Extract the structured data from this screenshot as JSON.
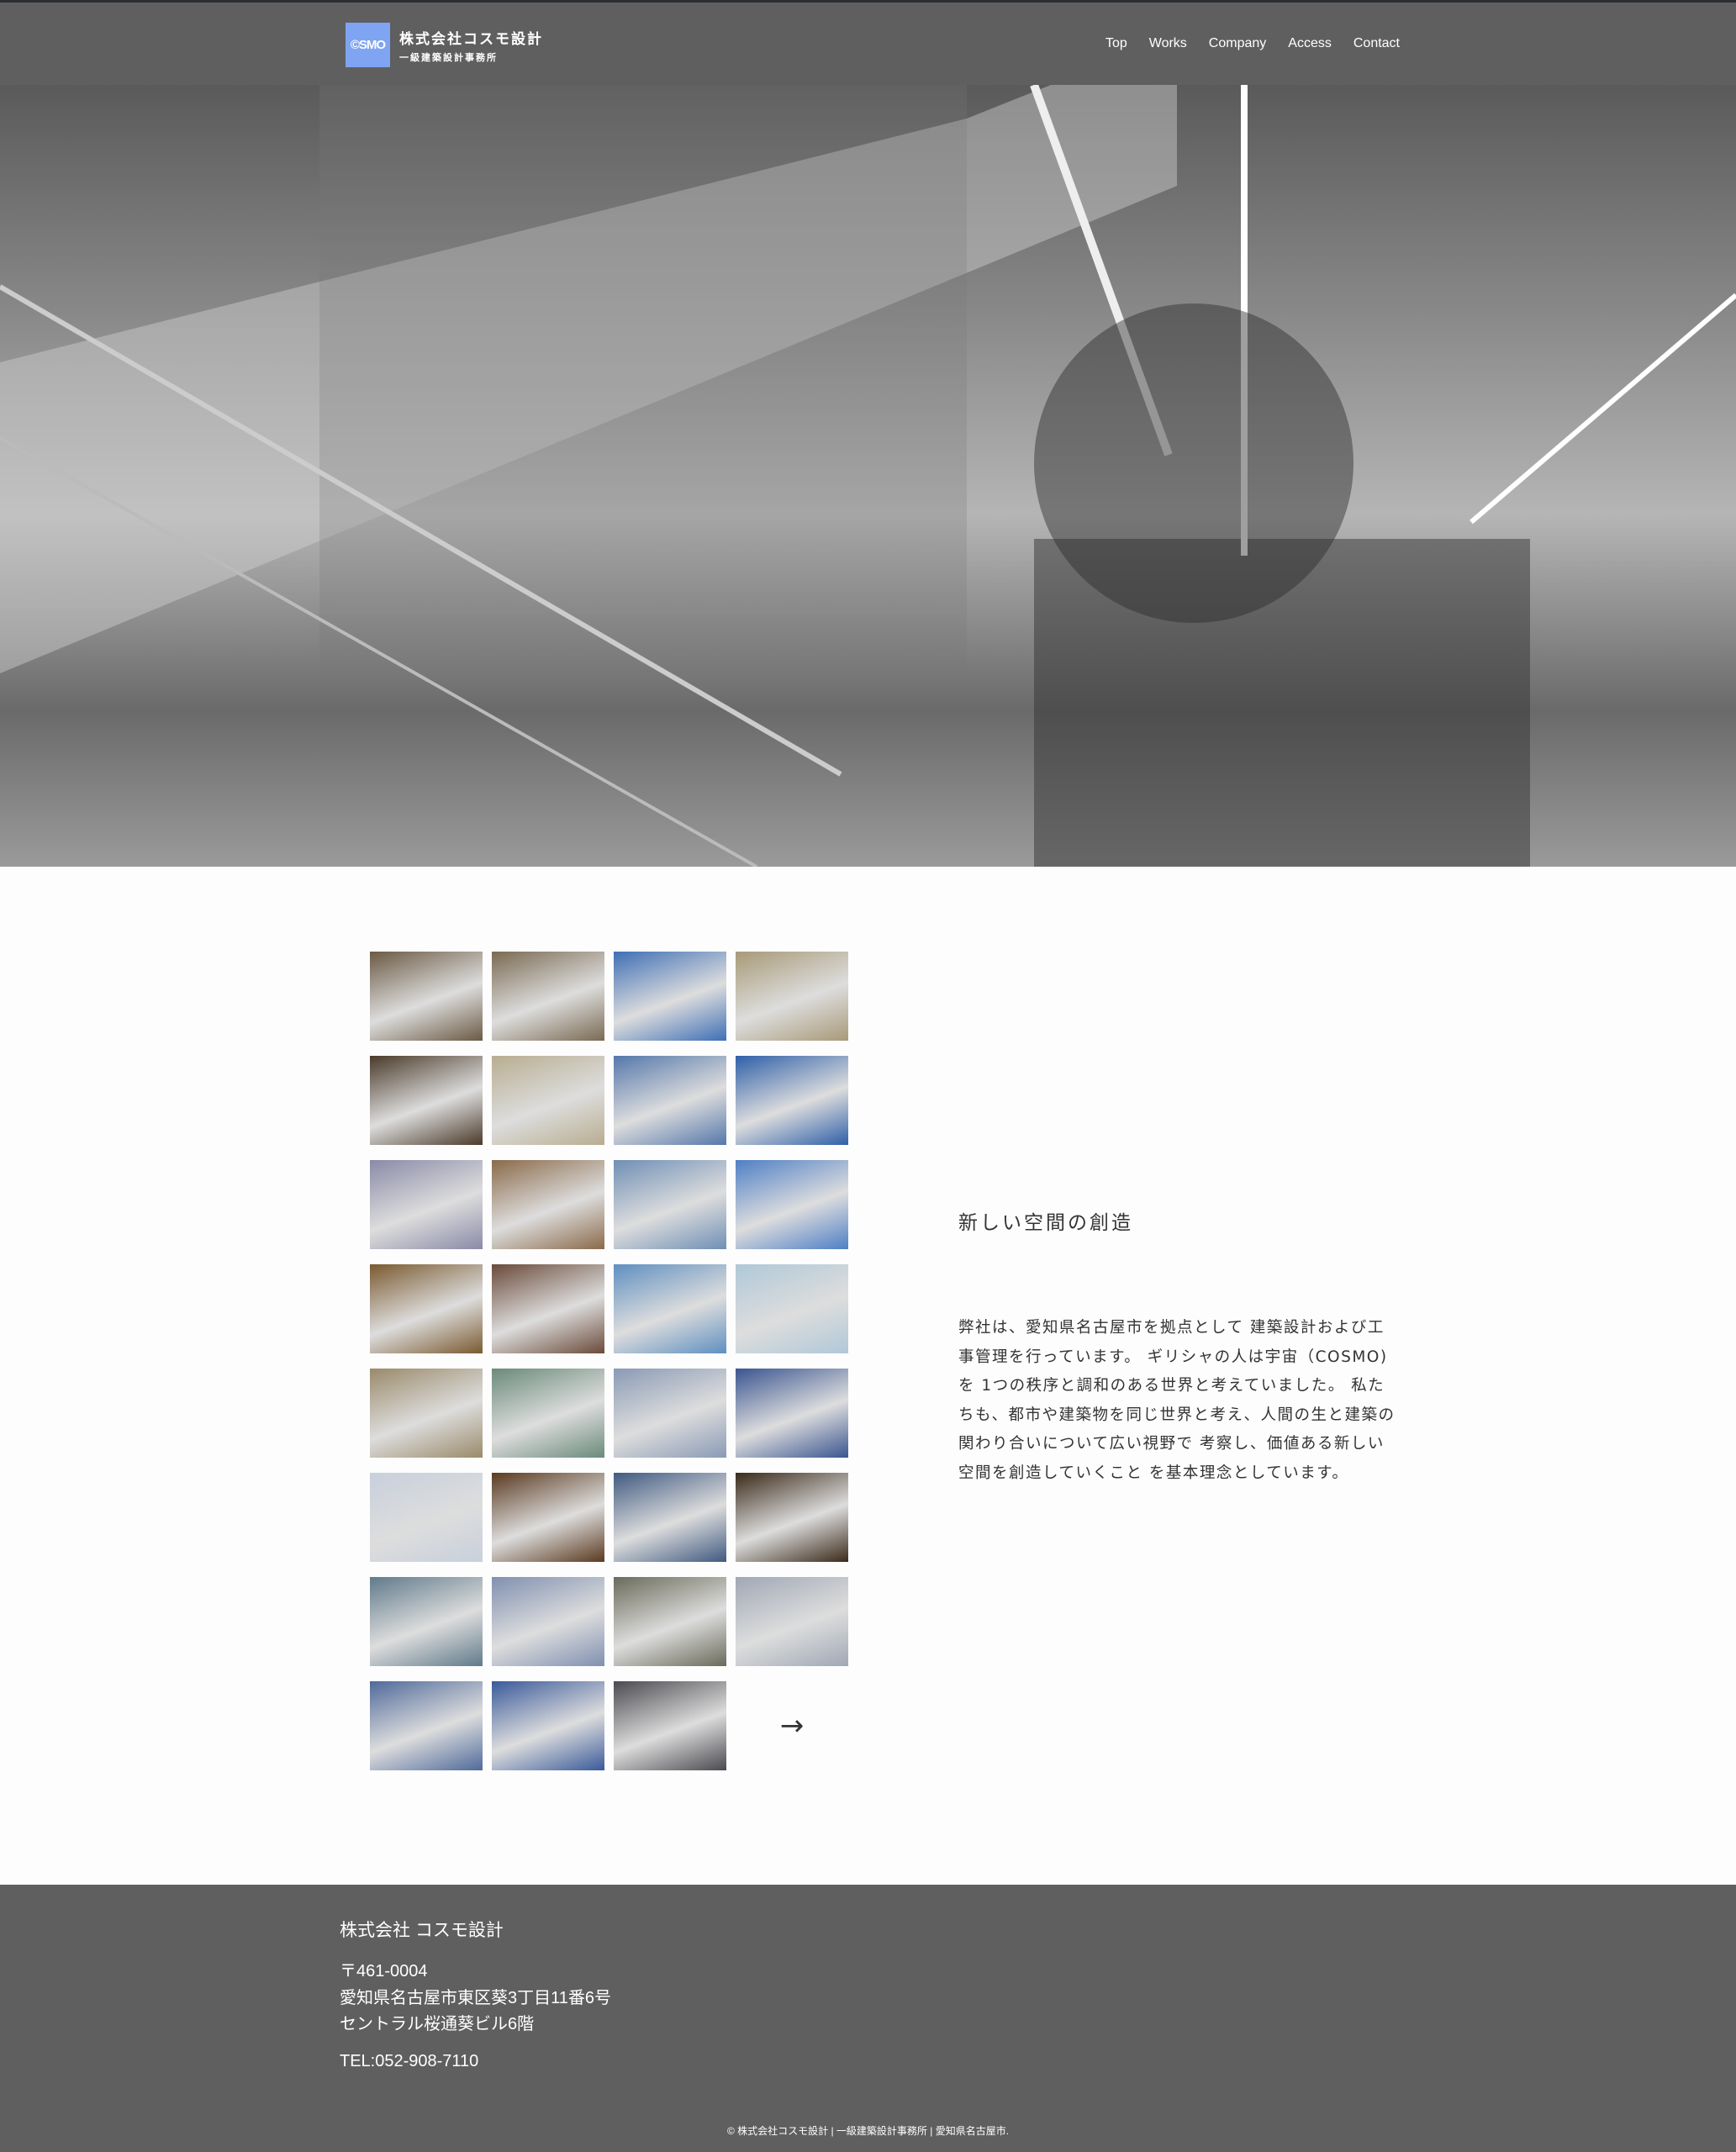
{
  "header": {
    "logo_mark": "©SMO",
    "logo_name": "株式会社コスモ設計",
    "logo_sub": "一級建築設計事務所",
    "nav": [
      "Top",
      "Works",
      "Company",
      "Access",
      "Contact"
    ]
  },
  "colors": {
    "header_bg": "#5f5f5f",
    "logo_bg": "#7fa4f2"
  },
  "gallery": {
    "thumbs": [
      "#6b5a44",
      "#7a6a52",
      "#3f6fb5",
      "#a89a78",
      "#4a3a2a",
      "#b8ad90",
      "#5577aa",
      "#2f5fa8",
      "#8a8aa8",
      "#8a6a4a",
      "#6f8fb5",
      "#4f7fc5",
      "#7a5a30",
      "#6a4a3a",
      "#5f8fc0",
      "#b0c8d8",
      "#9a8a6a",
      "#6a8a7a",
      "#8a9ab5",
      "#3a5590",
      "#c8d0dc",
      "#5a3a20",
      "#405a80",
      "#3a2a1a",
      "#607a8a",
      "#8090b0",
      "#6a6a5a",
      "#a0a8b5",
      "#506a9a",
      "#3a5a9a",
      "#4a4a50"
    ],
    "arrow": "→"
  },
  "intro": {
    "heading": "新しい空間の創造",
    "paragraph": "弊社は、愛知県名古屋市を拠点として 建築設計および工事管理を行っています。 ギリシャの人は宇宙（COSMO)を 1つの秩序と調和のある世界と考えていました。 私たちも、都市や建築物を同じ世界と考え、人間の生と建築の関わり合いについて広い視野で 考察し、価値ある新しい空間を創造していくこと を基本理念としています。"
  },
  "footer": {
    "company": "株式会社 コスモ設計",
    "postal": "〒461-0004",
    "address1": "愛知県名古屋市東区葵3丁目11番6号",
    "address2": "セントラル桜通葵ビル6階",
    "tel": "TEL:052-908-7110",
    "copyright": "© 株式会社コスモ設計 | 一級建築設計事務所 | 愛知県名古屋市."
  }
}
